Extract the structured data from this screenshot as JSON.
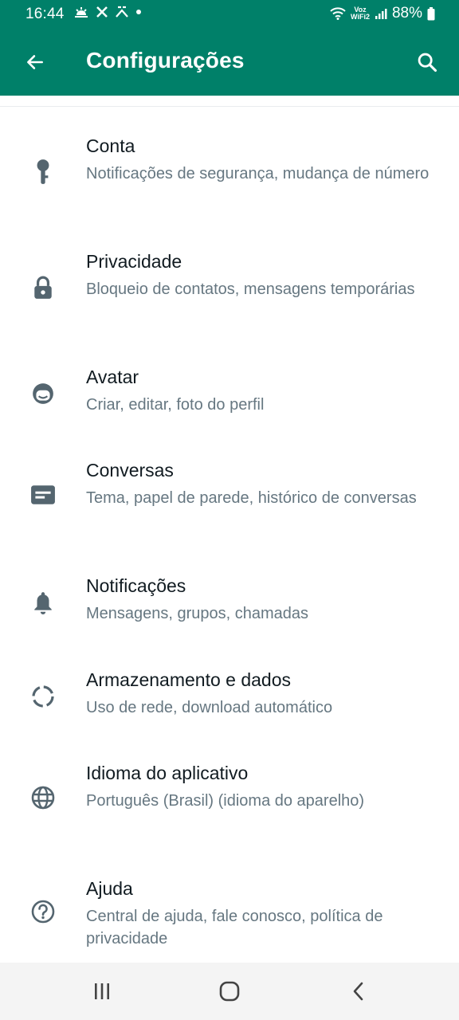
{
  "status_bar": {
    "time": "16:44",
    "network_label": "Voz\nWiFi2",
    "battery": "88%"
  },
  "app_bar": {
    "title": "Configurações",
    "back_icon": "arrow-back-icon",
    "search_icon": "search-icon"
  },
  "settings": [
    {
      "icon": "key-icon",
      "title": "Conta",
      "subtitle": "Notificações de segurança, mudança de número"
    },
    {
      "icon": "lock-icon",
      "title": "Privacidade",
      "subtitle": "Bloqueio de contatos, mensagens temporárias"
    },
    {
      "icon": "avatar-icon",
      "title": "Avatar",
      "subtitle": "Criar, editar, foto do perfil"
    },
    {
      "icon": "chat-icon",
      "title": "Conversas",
      "subtitle": "Tema, papel de parede, histórico de conversas"
    },
    {
      "icon": "bell-icon",
      "title": "Notificações",
      "subtitle": "Mensagens, grupos, chamadas"
    },
    {
      "icon": "storage-icon",
      "title": "Armazenamento e dados",
      "subtitle": "Uso de rede, download automático"
    },
    {
      "icon": "globe-icon",
      "title": "Idioma do aplicativo",
      "subtitle": "Português (Brasil) (idioma do aparelho)"
    },
    {
      "icon": "help-icon",
      "title": "Ajuda",
      "subtitle": "Central de ajuda, fale conosco, política de privacidade"
    }
  ],
  "colors": {
    "brand": "#008069",
    "title_text": "#111b21",
    "subtitle_text": "#667781",
    "icon": "#54656f"
  }
}
